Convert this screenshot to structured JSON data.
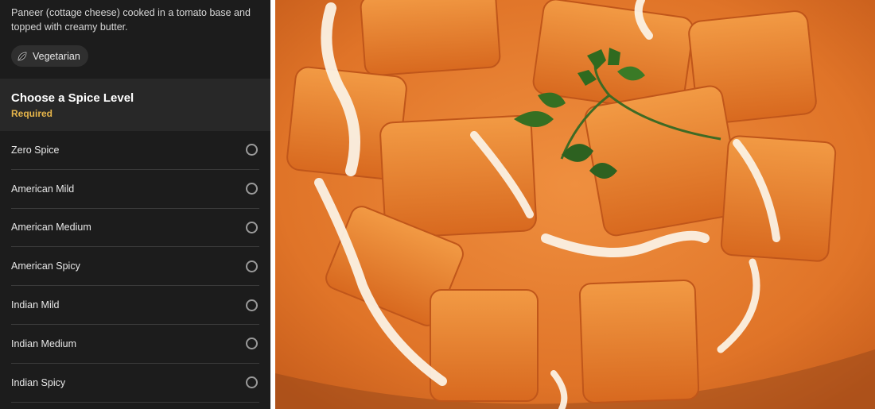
{
  "item": {
    "description": "Paneer (cottage cheese) cooked in a tomato base and topped with creamy butter.",
    "tag_icon": "leaf-icon",
    "tag_label": "Vegetarian"
  },
  "spice": {
    "title": "Choose a Spice Level",
    "required": "Required",
    "options": [
      {
        "label": "Zero Spice"
      },
      {
        "label": "American Mild"
      },
      {
        "label": "American Medium"
      },
      {
        "label": "American Spicy"
      },
      {
        "label": "Indian Mild"
      },
      {
        "label": "Indian Medium"
      },
      {
        "label": "Indian Spicy"
      }
    ]
  },
  "colors": {
    "panel_bg": "#1c1c1c",
    "header_bg": "#282828",
    "required_accent": "#e6b54a",
    "curry": "#e3782a"
  }
}
